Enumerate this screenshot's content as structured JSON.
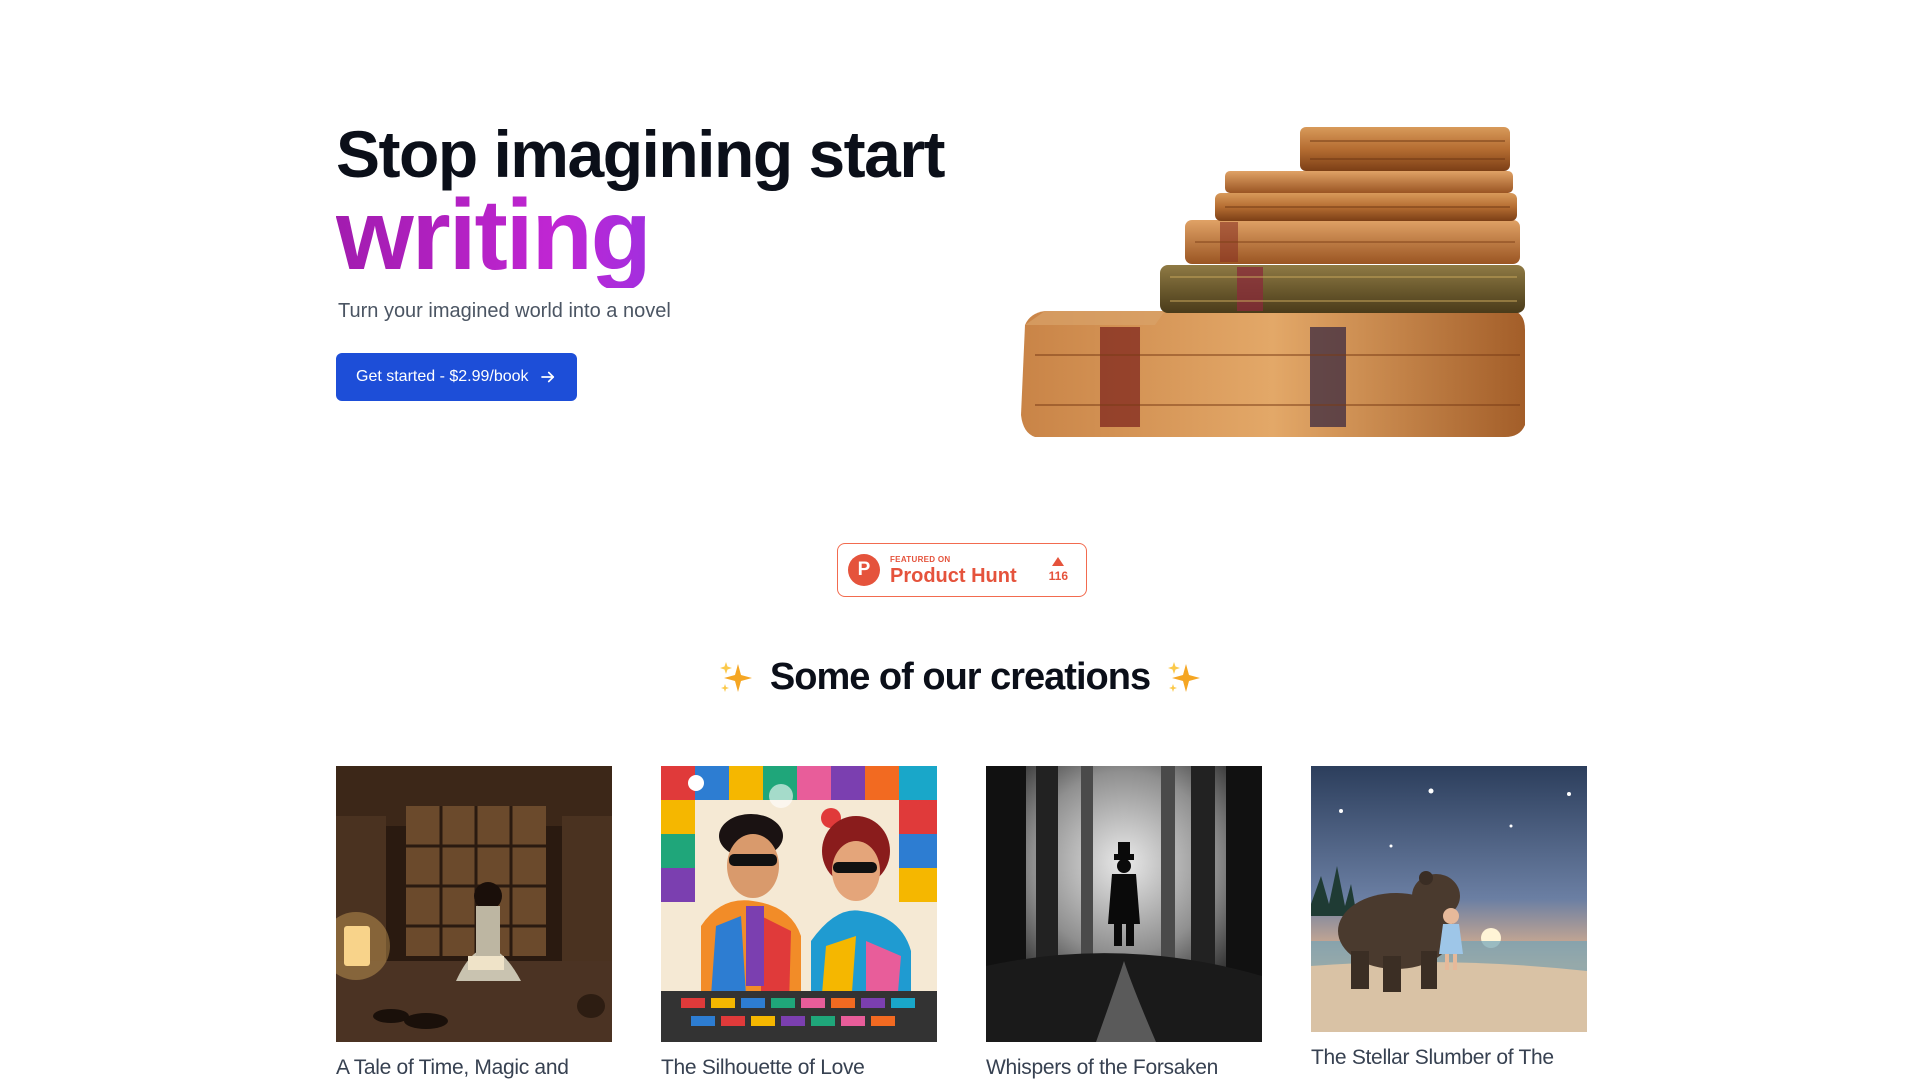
{
  "hero": {
    "title_line1": "Stop imagining start",
    "title_accent": "writing",
    "subtitle": "Turn your imagined world into a novel",
    "cta_label": "Get started - $2.99/book"
  },
  "product_hunt": {
    "featured_label": "FEATURED ON",
    "name": "Product Hunt",
    "logo_letter": "P",
    "votes": "116"
  },
  "creations": {
    "heading": "Some of our creations",
    "books": [
      {
        "title": "A Tale of Time, Magic and"
      },
      {
        "title": "The Silhouette of Love"
      },
      {
        "title": "Whispers of the Forsaken"
      },
      {
        "title": "The Stellar Slumber of The"
      }
    ]
  },
  "colors": {
    "primary": "#1d4ed8",
    "product_hunt": "#e5533c",
    "accent_gradient": [
      "#a21caf",
      "#7c3aed",
      "#3b82f6"
    ]
  }
}
